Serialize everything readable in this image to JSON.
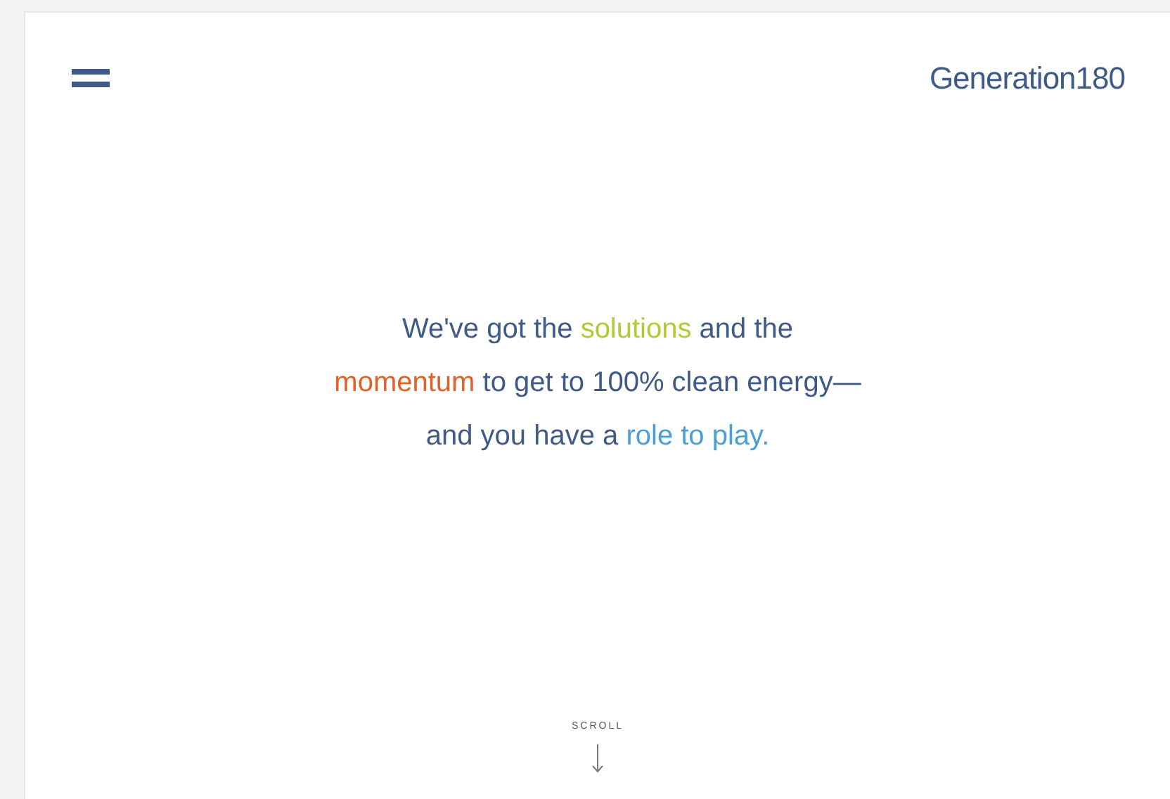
{
  "header": {
    "logo": "Generation180"
  },
  "hero": {
    "lines": [
      [
        {
          "text": "We've got the ",
          "color": "#3f5a86"
        },
        {
          "text": "solutions",
          "color": "#b5c934"
        },
        {
          "text": " and the",
          "color": "#3f5a86"
        }
      ],
      [
        {
          "text": "momentum",
          "color": "#e0622a"
        },
        {
          "text": " to get to 100% clean energy—",
          "color": "#3f5a86"
        }
      ],
      [
        {
          "text": "and you have a ",
          "color": "#3f5a86"
        },
        {
          "text": "role to play.",
          "color": "#4a9fd8"
        }
      ]
    ]
  },
  "scroll": {
    "label": "SCROLL"
  }
}
